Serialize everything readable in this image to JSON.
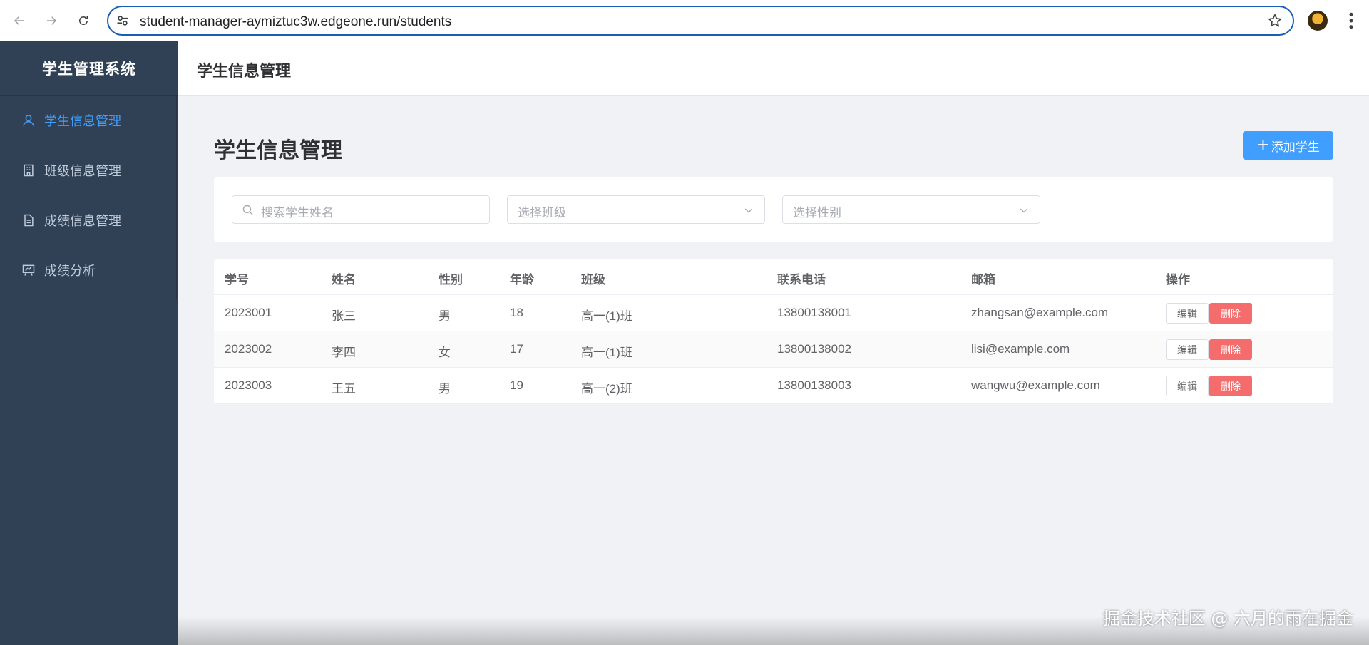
{
  "browser": {
    "url": "student-manager-aymiztuc3w.edgeone.run/students"
  },
  "sidebar": {
    "brand": "学生管理系统",
    "items": [
      {
        "label": "学生信息管理",
        "icon": "user-icon",
        "active": true
      },
      {
        "label": "班级信息管理",
        "icon": "building-icon",
        "active": false
      },
      {
        "label": "成绩信息管理",
        "icon": "document-icon",
        "active": false
      },
      {
        "label": "成绩分析",
        "icon": "chart-board-icon",
        "active": false
      }
    ]
  },
  "header": {
    "title": "学生信息管理"
  },
  "main": {
    "title": "学生信息管理",
    "add_button": "添加学生",
    "filters": {
      "search_placeholder": "搜索学生姓名",
      "class_placeholder": "选择班级",
      "gender_placeholder": "选择性别"
    },
    "table": {
      "headers": [
        "学号",
        "姓名",
        "性别",
        "年龄",
        "班级",
        "联系电话",
        "邮箱",
        "操作"
      ],
      "rows": [
        {
          "id": "2023001",
          "name": "张三",
          "gender": "男",
          "age": "18",
          "class": "高一(1)班",
          "phone": "13800138001",
          "email": "zhangsan@example.com"
        },
        {
          "id": "2023002",
          "name": "李四",
          "gender": "女",
          "age": "17",
          "class": "高一(1)班",
          "phone": "13800138002",
          "email": "lisi@example.com"
        },
        {
          "id": "2023003",
          "name": "王五",
          "gender": "男",
          "age": "19",
          "class": "高一(2)班",
          "phone": "13800138003",
          "email": "wangwu@example.com"
        }
      ],
      "edit_label": "编辑",
      "delete_label": "删除"
    }
  },
  "watermark": "掘金技术社区 @ 六月的雨在掘金",
  "colors": {
    "sidebar_bg": "#304156",
    "accent": "#409eff",
    "danger": "#f56c6c"
  }
}
